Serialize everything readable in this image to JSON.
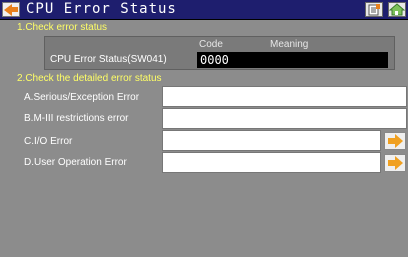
{
  "window": {
    "title": "CPU Error Status"
  },
  "section1": {
    "label": "1.Check error status",
    "columns": {
      "code": "Code",
      "meaning": "Meaning"
    },
    "row": {
      "label": "CPU Error Status(SW041)",
      "code": "0000",
      "meaning": ""
    }
  },
  "section2": {
    "label": "2.Check the detailed error status",
    "items": [
      {
        "label": "A.Serious/Exception Error",
        "value": "",
        "has_arrow": false
      },
      {
        "label": "B.M-III restrictions error",
        "value": "",
        "has_arrow": false
      },
      {
        "label": "C.I/O Error",
        "value": "",
        "has_arrow": true
      },
      {
        "label": "D.User Operation Error",
        "value": "",
        "has_arrow": true
      }
    ]
  },
  "colors": {
    "title_bg": "#1e1e6e",
    "section_text": "#ffff66",
    "background": "#8c8c8c",
    "arrow": "#f0a020"
  },
  "icons": {
    "back": "back-arrow-icon",
    "document": "document-icon",
    "home": "home-icon",
    "detail_arrow": "right-arrow-icon"
  }
}
